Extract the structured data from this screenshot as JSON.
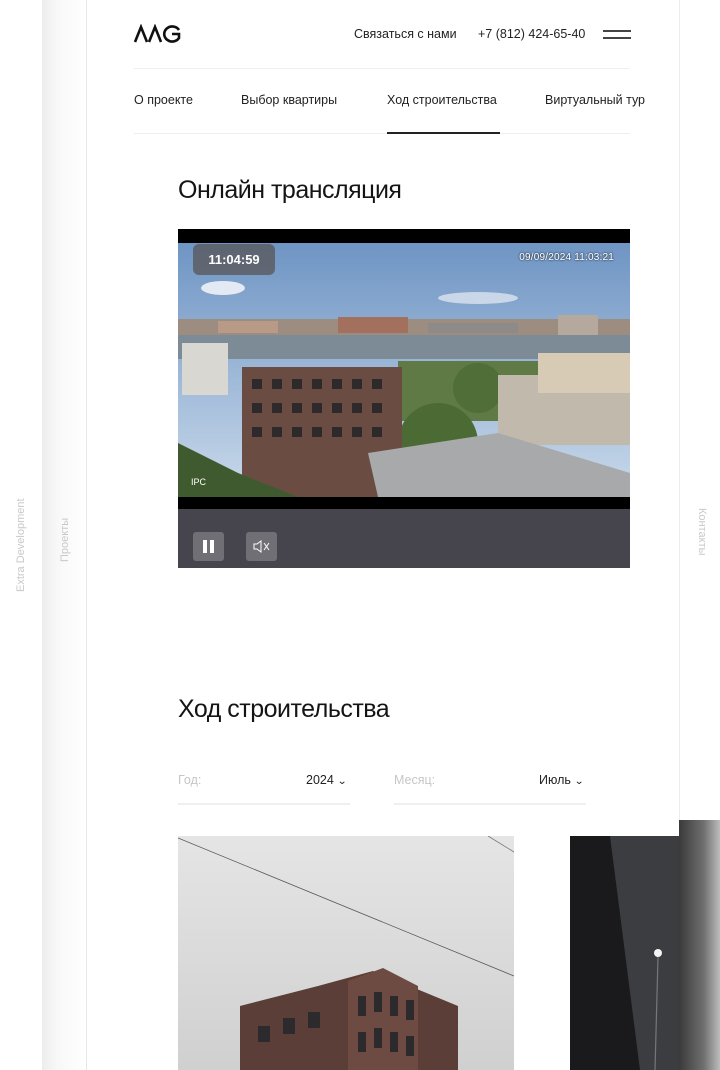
{
  "brand": {
    "company": "Extra Development"
  },
  "side_nav": {
    "left_label": "Проекты",
    "right_label": "Контакты"
  },
  "header": {
    "contact_label": "Связаться с нами",
    "phone": "+7 (812) 424-65-40"
  },
  "tabs": [
    {
      "label": "О проекте",
      "active": false
    },
    {
      "label": "Выбор квартиры",
      "active": false
    },
    {
      "label": "Ход строительства",
      "active": true
    },
    {
      "label": "Виртуальный тур",
      "active": false
    }
  ],
  "live": {
    "title": "Онлайн трансляция",
    "time": "11:04:59",
    "camera_timestamp": "09/09/2024 11:03:21",
    "camera_brand": "IPC"
  },
  "progress": {
    "title": "Ход строительства",
    "year_label": "Год:",
    "year_value": "2024",
    "month_label": "Месяц:",
    "month_value": "Июль"
  },
  "icons": {
    "logo": "brand-logo",
    "menu": "hamburger-icon",
    "pause": "pause-icon",
    "mute": "speaker-muted-icon",
    "dropdown": "chevron-down-icon"
  },
  "colors": {
    "text": "#1a1a1a",
    "muted": "#c6c6c6",
    "player_controls": "#46454d"
  }
}
